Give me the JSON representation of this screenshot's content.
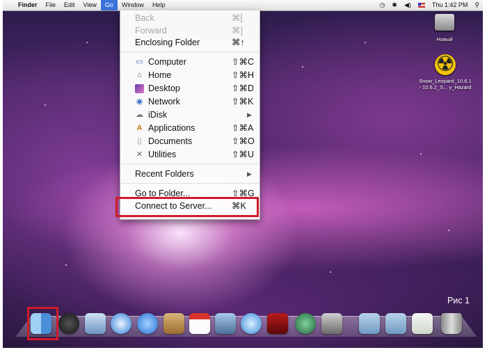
{
  "menubar": {
    "apple_glyph": "",
    "app_name": "Finder",
    "menus": [
      "File",
      "Edit",
      "View",
      "Go",
      "Window",
      "Help"
    ],
    "clock": "Thu 1:42 PM"
  },
  "go_menu": {
    "items": [
      {
        "label": "Back",
        "shortcut": "⌘[",
        "enabled": false
      },
      {
        "label": "Forward",
        "shortcut": "⌘]",
        "enabled": false
      },
      {
        "label": "Enclosing Folder",
        "shortcut": "⌘↑",
        "enabled": true
      },
      {
        "label": "Computer",
        "shortcut": "⇧⌘C",
        "icon": "computer-icon"
      },
      {
        "label": "Home",
        "shortcut": "⇧⌘H",
        "icon": "home-icon"
      },
      {
        "label": "Desktop",
        "shortcut": "⇧⌘D",
        "icon": "desktop-icon"
      },
      {
        "label": "Network",
        "shortcut": "⇧⌘K",
        "icon": "network-icon"
      },
      {
        "label": "iDisk",
        "shortcut": "▶",
        "icon": "idisk-icon"
      },
      {
        "label": "Applications",
        "shortcut": "⇧⌘A",
        "icon": "applications-icon"
      },
      {
        "label": "Documents",
        "shortcut": "⇧⌘O",
        "icon": "documents-icon"
      },
      {
        "label": "Utilities",
        "shortcut": "⇧⌘U",
        "icon": "utilities-icon"
      },
      {
        "label": "Recent Folders",
        "shortcut": "▶"
      },
      {
        "label": "Go to Folder...",
        "shortcut": "⇧⌘G"
      },
      {
        "label": "Connect to Server...",
        "shortcut": "⌘K"
      }
    ]
  },
  "desktop": {
    "hd_label": "Новый",
    "dmg_label_line1": "Snow_Leopard_10.6.1",
    "dmg_label_line2": "- 10.6.2_S... y_Hazard",
    "figure_label": "Рис 1"
  },
  "dock": {
    "items": [
      "Finder",
      "Dashboard",
      "Mail",
      "Safari",
      "iChat",
      "Address Book",
      "iCal",
      "Preview",
      "iTunes",
      "Photo Booth",
      "Time Machine",
      "System Preferences",
      "Applications",
      "Documents",
      "Downloads",
      "Trash"
    ]
  }
}
